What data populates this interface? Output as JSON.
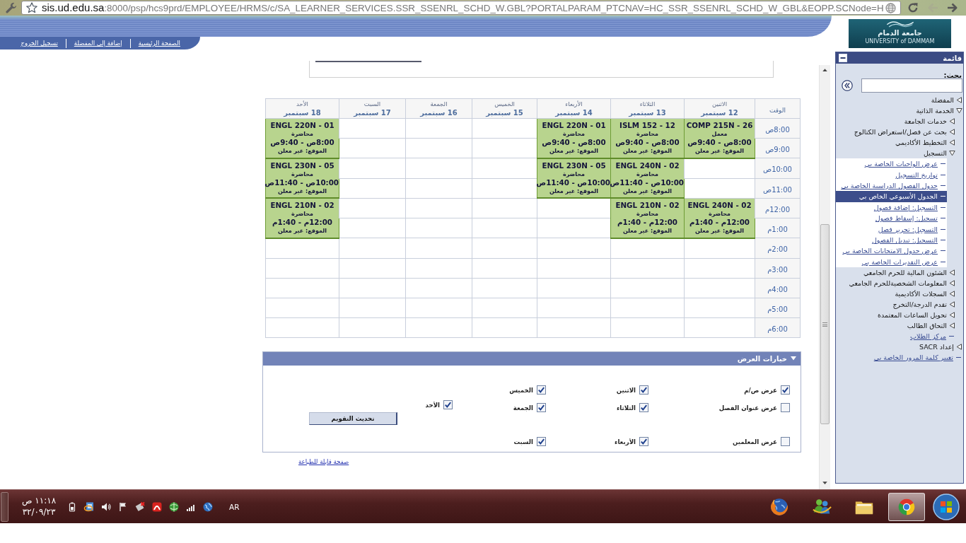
{
  "browser": {
    "url_host": "sis.ud.edu.sa",
    "url_path": ":8000/psp/hcs9prd/EMPLOYEE/HRMS/c/SA_LEARNER_SERVICES.SSR_SSENRL_SCHD_W.GBL?PORTALPARAM_PTCNAV=HC_SSR_SSENRL_SCHD_W_GBL&EOPP.SCNode=H",
    "nav_buttons": [
      {
        "kind": "reload",
        "disabled": false
      },
      {
        "kind": "forward",
        "disabled": true
      },
      {
        "kind": "back",
        "disabled": false
      }
    ]
  },
  "header": {
    "logo": {
      "name": "جامعة الدمام",
      "subtitle": "UNIVERSITY of DAMMAM"
    },
    "links": [
      "الصفحة الرئيسية",
      "إضافة إلى المفضلة",
      "تسجيل الخروج"
    ]
  },
  "sidebar": {
    "title": "قائمة",
    "search_label": "بحث:",
    "items": [
      {
        "kind": "folder",
        "label": "المفضلة",
        "expanded": false
      },
      {
        "kind": "folder",
        "label": "الخدمة الذاتية",
        "expanded": true,
        "children": [
          {
            "kind": "folder",
            "label": "خدمات الجامعة",
            "expanded": false
          },
          {
            "kind": "folder",
            "label": "بحث عن فصل/استعراض الكتالوج",
            "expanded": false
          },
          {
            "kind": "folder",
            "label": "التخطيط الأكاديمي",
            "expanded": false
          },
          {
            "kind": "folder",
            "label": "التسجيل",
            "expanded": true,
            "children": [
              {
                "kind": "link",
                "label": "عرض الواجبات الخاصة بي",
                "selected": false
              },
              {
                "kind": "link",
                "label": "تواريخ التسجيل",
                "selected": false
              },
              {
                "kind": "link",
                "label": "جدول الفصول الدراسية الخاصة بي",
                "selected": false
              },
              {
                "kind": "link",
                "label": "الجدول الأسبوعي الخاص بي",
                "selected": true
              },
              {
                "kind": "link",
                "label": "التسجيل: إضافة فصول",
                "selected": false
              },
              {
                "kind": "link",
                "label": "تسجيل: إسقاط فصول",
                "selected": false
              },
              {
                "kind": "link",
                "label": "التسجيل: تحرير فصل",
                "selected": false
              },
              {
                "kind": "link",
                "label": "التسجيل: تبديل الفصول",
                "selected": false
              },
              {
                "kind": "link",
                "label": "عرض جدول الامتحانات الخاصة بي",
                "selected": false
              },
              {
                "kind": "link",
                "label": "عرض التقديرات الخاصة بي",
                "selected": false
              }
            ]
          },
          {
            "kind": "folder",
            "label": "الشئون المالية للحرم الجامعي",
            "expanded": false
          },
          {
            "kind": "folder",
            "label": "المعلومات الشخصيةللحرم الجامعي",
            "expanded": false
          },
          {
            "kind": "folder",
            "label": "السجلات الأكاديمية",
            "expanded": false
          },
          {
            "kind": "folder",
            "label": "تقدم الدرجة/التخرج",
            "expanded": false
          },
          {
            "kind": "folder",
            "label": "تحويل الساعات المعتمدة",
            "expanded": false
          },
          {
            "kind": "folder",
            "label": "التحاق الطالب",
            "expanded": false
          },
          {
            "kind": "link",
            "label": "مركز الطلاب",
            "selected": false
          }
        ]
      },
      {
        "kind": "folder",
        "label": "إعداد SACR",
        "expanded": false
      },
      {
        "kind": "link",
        "label": "تغيير كلمة المرور الخاصة بي",
        "selected": false
      }
    ]
  },
  "calendar": {
    "time_header": "الوقت",
    "days": [
      {
        "name": "الاثنين",
        "date": "12 سبتمبر"
      },
      {
        "name": "الثلاثاء",
        "date": "13 سبتمبر"
      },
      {
        "name": "الأربعاء",
        "date": "14 سبتمبر"
      },
      {
        "name": "الخميس",
        "date": "15 سبتمبر"
      },
      {
        "name": "الجمعة",
        "date": "16 سبتمبر"
      },
      {
        "name": "السبت",
        "date": "17 سبتمبر"
      },
      {
        "name": "الأحد",
        "date": "18 سبتمبر"
      }
    ],
    "rows": [
      {
        "times": [
          "8:00ص",
          "9:00ص"
        ],
        "cells": [
          {
            "kind": "class",
            "course": "COMP 215N - 26",
            "type": "معمل",
            "time": "8:00ص - 9:40ص",
            "location": "الموقع: غير معلن"
          },
          {
            "kind": "class",
            "course": "ISLM 152 - 12",
            "type": "محاضرة",
            "time": "8:00ص - 9:40ص",
            "location": "الموقع: غير معلن"
          },
          {
            "kind": "class",
            "course": "ENGL 220N - 01",
            "type": "محاضرة",
            "time": "8:00ص - 9:40ص",
            "location": "الموقع: غير معلن"
          },
          {
            "kind": "empty"
          },
          {
            "kind": "empty"
          },
          {
            "kind": "empty"
          },
          {
            "kind": "class",
            "course": "ENGL 220N - 01",
            "type": "محاضرة",
            "time": "8:00ص - 9:40ص",
            "location": "الموقع: غير معلن"
          }
        ]
      },
      {
        "times": [
          "10:00ص",
          "11:00ص"
        ],
        "cells": [
          {
            "kind": "empty"
          },
          {
            "kind": "class",
            "course": "ENGL 240N - 02",
            "type": "محاضرة",
            "time": "10:00ص - 11:40ص",
            "location": "الموقع: غير معلن"
          },
          {
            "kind": "class",
            "course": "ENGL 230N - 05",
            "type": "محاضرة",
            "time": "10:00ص - 11:40ص",
            "location": "الموقع: غير معلن"
          },
          {
            "kind": "empty"
          },
          {
            "kind": "empty"
          },
          {
            "kind": "empty"
          },
          {
            "kind": "class",
            "course": "ENGL 230N - 05",
            "type": "محاضرة",
            "time": "10:00ص - 11:40ص",
            "location": "الموقع: غير معلن"
          }
        ]
      },
      {
        "times": [
          "12:00م",
          "1:00م"
        ],
        "cells": [
          {
            "kind": "class",
            "course": "ENGL 240N - 02",
            "type": "محاضرة",
            "time": "12:00م - 1:40م",
            "location": "الموقع: غير معلن"
          },
          {
            "kind": "class",
            "course": "ENGL 210N - 02",
            "type": "محاضرة",
            "time": "12:00م - 1:40م",
            "location": "الموقع: غير معلن"
          },
          {
            "kind": "empty"
          },
          {
            "kind": "empty"
          },
          {
            "kind": "empty"
          },
          {
            "kind": "empty"
          },
          {
            "kind": "class",
            "course": "ENGL 210N - 02",
            "type": "محاضرة",
            "time": "12:00م - 1:40م",
            "location": "الموقع: غير معلن"
          }
        ]
      },
      {
        "times": [
          "2:00م"
        ]
      },
      {
        "times": [
          "3:00م"
        ]
      },
      {
        "times": [
          "4:00م"
        ]
      },
      {
        "times": [
          "5:00م"
        ]
      },
      {
        "times": [
          "6:00م"
        ]
      }
    ]
  },
  "display_options": {
    "title": "خيارات العرض",
    "expanded": true,
    "columns": [
      {
        "options": [
          {
            "label": "عرض ص/م",
            "checked": true
          },
          {
            "label": "عرض عنوان الفصل",
            "checked": false
          },
          {
            "label": "عرض المعلمين",
            "checked": false
          }
        ]
      },
      {
        "options": [
          {
            "label": "الاثنين",
            "checked": true
          },
          {
            "label": "الثلاثاء",
            "checked": true
          },
          {
            "label": "الأربعاء",
            "checked": true
          }
        ]
      },
      {
        "options": [
          {
            "label": "الخميس",
            "checked": true
          },
          {
            "label": "الجمعة",
            "checked": true
          },
          {
            "label": "السبت",
            "checked": true
          }
        ]
      },
      {
        "options": [
          {
            "label": "الأحد",
            "checked": true
          }
        ]
      }
    ],
    "button": "تحديث التقويم"
  },
  "print_link": "صفحة قابلة للطباعة",
  "taskbar": {
    "clock": {
      "time": "١١:١٨ ص",
      "date": "٣٢/٠٩/٢٣"
    },
    "language": "AR",
    "apps": [
      {
        "kind": "globe",
        "active": false
      },
      {
        "kind": "people",
        "active": false
      },
      {
        "kind": "folder",
        "active": false
      },
      {
        "kind": "wheel",
        "active": true
      }
    ]
  }
}
